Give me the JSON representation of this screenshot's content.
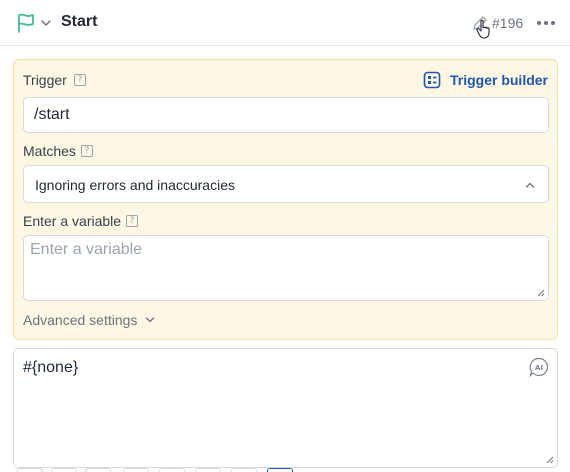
{
  "header": {
    "title": "Start",
    "node_id": "#196",
    "icons": [
      "flag-icon",
      "chevron-down-icon",
      "pencil-icon",
      "pointer-cursor-icon",
      "more-icon"
    ],
    "accent_color": "#3fbf8f"
  },
  "trigger": {
    "label": "Trigger",
    "builder_label": "Trigger builder",
    "value": "/start",
    "help_icon": "?",
    "panel_color": "#fdf7e4",
    "link_color": "#1e56b0"
  },
  "matches": {
    "label": "Matches",
    "help_icon": "?",
    "selected": "Ignoring errors and inaccuracies"
  },
  "variable": {
    "label": "Enter a variable",
    "help_icon": "?",
    "placeholder": "Enter a variable",
    "value": ""
  },
  "advanced": {
    "label": "Advanced settings"
  },
  "message": {
    "text": "#{none}",
    "ai_label": "AI"
  }
}
